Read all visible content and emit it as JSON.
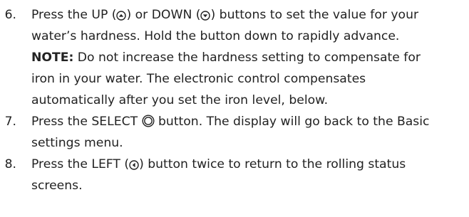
{
  "steps": [
    {
      "number": "6.",
      "segments": {
        "a": "Press the UP (",
        "b": ") or DOWN (",
        "c": ") buttons to set the value for your",
        "d": "water’s hardness. Hold the button down to rapidly advance.",
        "note_label": "NOTE:",
        "e": " Do not increase the hardness setting to compensate for",
        "f": "iron in your water. The electronic control compensates",
        "g": "automatically after you set the iron level, below."
      }
    },
    {
      "number": "7.",
      "segments": {
        "a": "Press the SELECT ",
        "b": " button. The display will go back to the Basic",
        "c": "settings menu."
      }
    },
    {
      "number": "8.",
      "segments": {
        "a": "Press the LEFT (",
        "b": ") button twice to return to the rolling status",
        "c": "screens."
      }
    }
  ],
  "icons": {
    "up": "up-button-icon",
    "down": "down-button-icon",
    "select": "select-button-icon",
    "left": "left-button-icon"
  },
  "colors": {
    "text": "#222222",
    "background": "#ffffff"
  }
}
